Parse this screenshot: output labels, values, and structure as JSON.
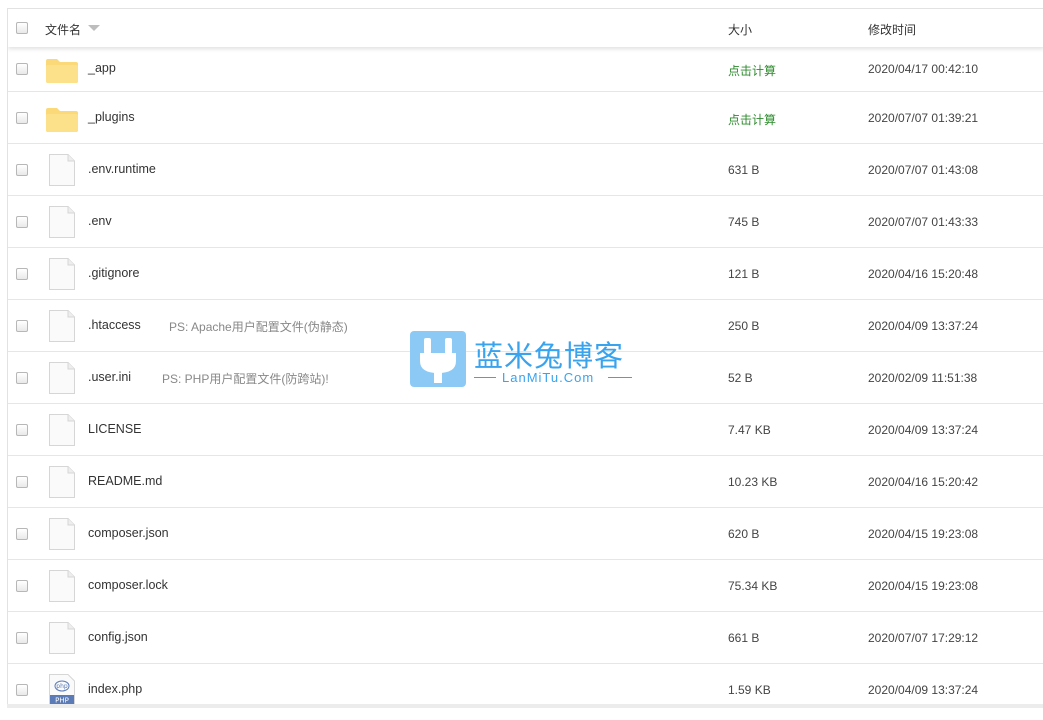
{
  "header": {
    "col_name": "文件名",
    "col_size": "大小",
    "col_time": "修改时间"
  },
  "files": [
    {
      "name": "_app",
      "type": "folder",
      "size": "点击计算",
      "time": "2020/04/17 00:42:10",
      "note": ""
    },
    {
      "name": "_plugins",
      "type": "folder",
      "size": "点击计算",
      "time": "2020/07/07 01:39:21",
      "note": ""
    },
    {
      "name": ".env.runtime",
      "type": "file",
      "size": "631 B",
      "time": "2020/07/07 01:43:08",
      "note": ""
    },
    {
      "name": ".env",
      "type": "file",
      "size": "745 B",
      "time": "2020/07/07 01:43:33",
      "note": ""
    },
    {
      "name": ".gitignore",
      "type": "file",
      "size": "121 B",
      "time": "2020/04/16 15:20:48",
      "note": ""
    },
    {
      "name": ".htaccess",
      "type": "file",
      "size": "250 B",
      "time": "2020/04/09 13:37:24",
      "note": "PS: Apache用户配置文件(伪静态)"
    },
    {
      "name": ".user.ini",
      "type": "file",
      "size": "52 B",
      "time": "2020/02/09 11:51:38",
      "note": "PS: PHP用户配置文件(防跨站)!"
    },
    {
      "name": "LICENSE",
      "type": "file",
      "size": "7.47 KB",
      "time": "2020/04/09 13:37:24",
      "note": ""
    },
    {
      "name": "README.md",
      "type": "file",
      "size": "10.23 KB",
      "time": "2020/04/16 15:20:42",
      "note": ""
    },
    {
      "name": "composer.json",
      "type": "file",
      "size": "620 B",
      "time": "2020/04/15 19:23:08",
      "note": ""
    },
    {
      "name": "composer.lock",
      "type": "file",
      "size": "75.34 KB",
      "time": "2020/04/15 19:23:08",
      "note": ""
    },
    {
      "name": "config.json",
      "type": "file",
      "size": "661 B",
      "time": "2020/07/07 17:29:12",
      "note": ""
    },
    {
      "name": "index.php",
      "type": "php",
      "size": "1.59 KB",
      "time": "2020/04/09 13:37:24",
      "note": ""
    }
  ],
  "watermark": {
    "title": "蓝米兔博客",
    "subtitle": "LanMiTu.Com"
  },
  "colors": {
    "folder": "#fbd978",
    "calc_link": "#2e8b2e",
    "watermark": "#3aa3ee"
  }
}
